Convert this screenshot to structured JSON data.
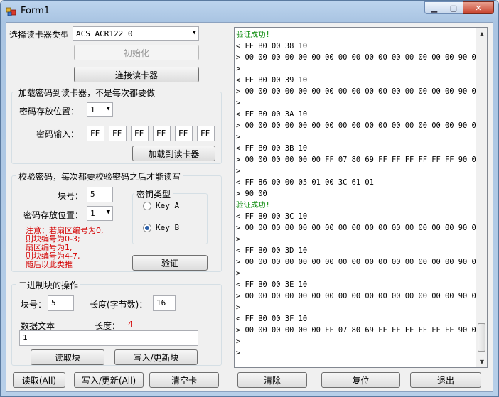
{
  "window": {
    "title": "Form1"
  },
  "reader": {
    "type_label": "选择读卡器类型",
    "type_value": "ACS ACR122 0",
    "init_button": "初始化",
    "connect_button": "连接读卡器"
  },
  "load_key": {
    "group_title": "加载密码到读卡器，不是每次都要做",
    "slot_label": "密码存放位置：",
    "slot_value": "1",
    "input_label": "密码输入：",
    "key_bytes": [
      "FF",
      "FF",
      "FF",
      "FF",
      "FF",
      "FF"
    ],
    "load_button": "加载到读卡器"
  },
  "verify": {
    "group_title": "校验密码，每次都要校验密码之后才能读写",
    "block_label": "块号：",
    "block_value": "5",
    "slot_label": "密码存放位置：",
    "slot_value": "1",
    "key_type_title": "密钥类型",
    "key_a": "Key A",
    "key_b": "Key B",
    "selected_key": "Key B",
    "note_lines": [
      "注意：若扇区编号为0,",
      "则块编号为0-3;",
      "扇区编号为1,",
      "则块编号为4-7,",
      "随后以此类推"
    ],
    "verify_button": "验证"
  },
  "binary": {
    "group_title": "二进制块的操作",
    "block_label": "块号：",
    "block_value": "5",
    "length_label": "长度(字节数)：",
    "length_value": "16",
    "data_label": "数据文本",
    "data_length_label": "长度：",
    "data_length_value": "4",
    "data_value": "1",
    "read_button": "读取块",
    "write_button": "写入/更新块"
  },
  "bottom": {
    "read_all": "读取(All)",
    "write_all": "写入/更新(All)",
    "clear_card": "清空卡",
    "clear": "清除",
    "reset": "复位",
    "exit": "退出"
  },
  "log": {
    "lines": [
      {
        "text": "验证成功!",
        "color": "#0a8a0a"
      },
      {
        "text": "< FF B0 00 38 10"
      },
      {
        "text": "> 00 00 00 00 00 00 00 00 00 00 00 00 00 00 00 00 90 00"
      },
      {
        "text": ">"
      },
      {
        "text": "< FF B0 00 39 10"
      },
      {
        "text": "> 00 00 00 00 00 00 00 00 00 00 00 00 00 00 00 00 90 00"
      },
      {
        "text": ">"
      },
      {
        "text": "< FF B0 00 3A 10"
      },
      {
        "text": "> 00 00 00 00 00 00 00 00 00 00 00 00 00 00 00 00 90 00"
      },
      {
        "text": ">"
      },
      {
        "text": "< FF B0 00 3B 10"
      },
      {
        "text": "> 00 00 00 00 00 00 FF 07 80 69 FF FF FF FF FF FF 90 00"
      },
      {
        "text": ">"
      },
      {
        "text": "< FF 86 00 00 05 01 00 3C 61 01"
      },
      {
        "text": "> 90 00"
      },
      {
        "text": "验证成功!",
        "color": "#0a8a0a"
      },
      {
        "text": "< FF B0 00 3C 10"
      },
      {
        "text": "> 00 00 00 00 00 00 00 00 00 00 00 00 00 00 00 00 90 00"
      },
      {
        "text": ">"
      },
      {
        "text": "< FF B0 00 3D 10"
      },
      {
        "text": "> 00 00 00 00 00 00 00 00 00 00 00 00 00 00 00 00 90 00"
      },
      {
        "text": ">"
      },
      {
        "text": "< FF B0 00 3E 10"
      },
      {
        "text": "> 00 00 00 00 00 00 00 00 00 00 00 00 00 00 00 00 90 00"
      },
      {
        "text": ">"
      },
      {
        "text": "< FF B0 00 3F 10"
      },
      {
        "text": "> 00 00 00 00 00 00 FF 07 80 69 FF FF FF FF FF FF 90 00"
      },
      {
        "text": ">"
      },
      {
        "text": ">"
      }
    ]
  },
  "icons": {
    "app": "app-icon",
    "minimize": "minimize-icon",
    "maximize": "maximize-icon",
    "close": "close-icon",
    "dropdown": "chevron-down-icon",
    "scroll_up": "scroll-up-icon",
    "scroll_down": "scroll-down-icon"
  }
}
